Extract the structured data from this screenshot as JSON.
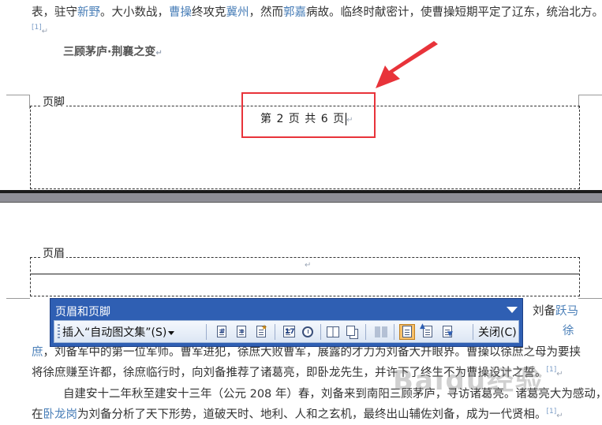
{
  "document": {
    "line_top": {
      "t1": "表，驻守",
      "l1": "新野",
      "t2": "。大小数战，",
      "l2": "曹操",
      "t3": "终攻克",
      "l3": "冀州",
      "t4": "，然而",
      "l4": "郭嘉",
      "t5": "病故。临终时献密计，使曹操短期平定了辽东，统治北方。"
    },
    "ref_top": "[1]",
    "heading": "三顾茅庐·荆襄之变",
    "para_mark": "↵",
    "line_a": {
      "t1": "刘备",
      "l1": "跃马"
    },
    "line_b": {
      "l1": "徐"
    },
    "line_c": {
      "l1": "庶",
      "t1": "，刘备军中的第一位军师。曹军进犯，徐庶大败曹军，展露的才力为刘备大开眼界。曹操以徐庶之母为要挟"
    },
    "line_d": {
      "t1": "将徐庶赚至许都，徐庶临行时，向刘备推荐了诸葛亮，即卧龙先生，并许下了终生不为曹操设计之誓。",
      "ref": "[1]"
    },
    "line_e": {
      "t1": "自建安十二年秋至建安十三年（公元 208 年）春，刘备来到南阳三顾茅庐，寻访诸葛亮。诸葛亮大为感动，"
    },
    "line_f": {
      "t1": "在",
      "l1": "卧龙岗",
      "t2": "为刘备分析了天下形势，道破天时、地利、人和之玄机，最终出山辅佐刘备，成为一代贤相。",
      "ref": "[1]"
    }
  },
  "footer": {
    "label": "页脚",
    "text": "第 2 页 共 6 页",
    "para_mark": "↵"
  },
  "header": {
    "label": "页眉",
    "para_mark": "↵"
  },
  "toolbar": {
    "title": "页眉和页脚",
    "insert_label": "插入“自动图文集”(S)",
    "close_label": "关闭(C)",
    "icons": [
      "insert-page-number-icon",
      "insert-page-count-icon",
      "format-page-number-icon",
      "insert-date-icon",
      "insert-time-icon",
      "page-setup-icon",
      "show-hide-text-icon",
      "same-as-previous-icon",
      "switch-header-footer-icon",
      "show-previous-icon",
      "show-next-icon"
    ]
  },
  "watermark": "Baidu经验",
  "colors": {
    "link": "#4a7fb8",
    "toolbar_title_bg": "#2f5fb3",
    "highlight": "#e8333a",
    "page_gap": "#8e8e96"
  }
}
